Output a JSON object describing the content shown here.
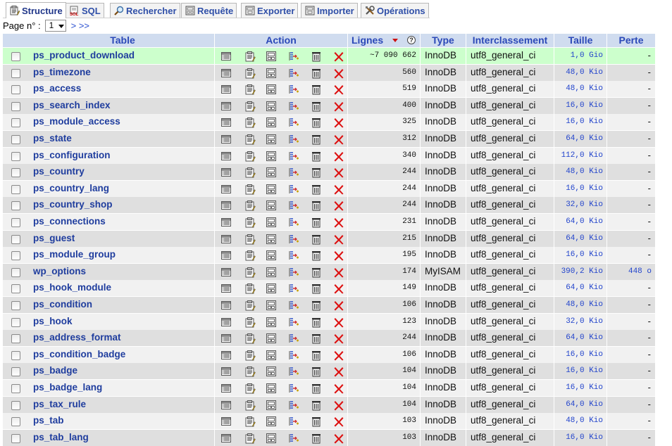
{
  "tabs": [
    {
      "label": "Structure",
      "icon": "structure-icon",
      "active": true
    },
    {
      "label": "SQL",
      "icon": "sql-icon",
      "active": false
    },
    {
      "label": "Rechercher",
      "icon": "search-icon",
      "active": false
    },
    {
      "label": "Requête",
      "icon": "query-icon",
      "active": false
    },
    {
      "label": "Exporter",
      "icon": "export-icon",
      "active": false
    },
    {
      "label": "Importer",
      "icon": "import-icon",
      "active": false
    },
    {
      "label": "Opérations",
      "icon": "operations-icon",
      "active": false
    }
  ],
  "pager": {
    "label": "Page n° :",
    "selected": "1",
    "next": "> >>"
  },
  "columns": {
    "table": "Table",
    "action": "Action",
    "lignes": "Lignes",
    "help": "?",
    "type": "Type",
    "collation": "Interclassement",
    "size": "Taille",
    "loss": "Perte"
  },
  "action_icons": [
    "browse-icon",
    "structure-icon",
    "search-icon",
    "insert-icon",
    "empty-icon",
    "drop-icon"
  ],
  "colors": {
    "header_bg": "#d0dcef",
    "row_odd": "#f1f1f1",
    "row_even": "#dfdfdf",
    "row_highlight": "#ccffcc",
    "link": "#1f3d9e"
  },
  "rows": [
    {
      "name": "ps_product_download",
      "rows": "~7 090 662",
      "type": "InnoDB",
      "collation": "utf8_general_ci",
      "size": "1,0 Gio",
      "loss": "-"
    },
    {
      "name": "ps_timezone",
      "rows": "560",
      "type": "InnoDB",
      "collation": "utf8_general_ci",
      "size": "48,0 Kio",
      "loss": "-"
    },
    {
      "name": "ps_access",
      "rows": "519",
      "type": "InnoDB",
      "collation": "utf8_general_ci",
      "size": "48,0 Kio",
      "loss": "-"
    },
    {
      "name": "ps_search_index",
      "rows": "400",
      "type": "InnoDB",
      "collation": "utf8_general_ci",
      "size": "16,0 Kio",
      "loss": "-"
    },
    {
      "name": "ps_module_access",
      "rows": "325",
      "type": "InnoDB",
      "collation": "utf8_general_ci",
      "size": "16,0 Kio",
      "loss": "-"
    },
    {
      "name": "ps_state",
      "rows": "312",
      "type": "InnoDB",
      "collation": "utf8_general_ci",
      "size": "64,0 Kio",
      "loss": "-"
    },
    {
      "name": "ps_configuration",
      "rows": "340",
      "type": "InnoDB",
      "collation": "utf8_general_ci",
      "size": "112,0 Kio",
      "loss": "-"
    },
    {
      "name": "ps_country",
      "rows": "244",
      "type": "InnoDB",
      "collation": "utf8_general_ci",
      "size": "48,0 Kio",
      "loss": "-"
    },
    {
      "name": "ps_country_lang",
      "rows": "244",
      "type": "InnoDB",
      "collation": "utf8_general_ci",
      "size": "16,0 Kio",
      "loss": "-"
    },
    {
      "name": "ps_country_shop",
      "rows": "244",
      "type": "InnoDB",
      "collation": "utf8_general_ci",
      "size": "32,0 Kio",
      "loss": "-"
    },
    {
      "name": "ps_connections",
      "rows": "231",
      "type": "InnoDB",
      "collation": "utf8_general_ci",
      "size": "64,0 Kio",
      "loss": "-"
    },
    {
      "name": "ps_guest",
      "rows": "215",
      "type": "InnoDB",
      "collation": "utf8_general_ci",
      "size": "64,0 Kio",
      "loss": "-"
    },
    {
      "name": "ps_module_group",
      "rows": "195",
      "type": "InnoDB",
      "collation": "utf8_general_ci",
      "size": "16,0 Kio",
      "loss": "-"
    },
    {
      "name": "wp_options",
      "rows": "174",
      "type": "MyISAM",
      "collation": "utf8_general_ci",
      "size": "390,2 Kio",
      "loss": "448 o"
    },
    {
      "name": "ps_hook_module",
      "rows": "149",
      "type": "InnoDB",
      "collation": "utf8_general_ci",
      "size": "64,0 Kio",
      "loss": "-"
    },
    {
      "name": "ps_condition",
      "rows": "106",
      "type": "InnoDB",
      "collation": "utf8_general_ci",
      "size": "48,0 Kio",
      "loss": "-"
    },
    {
      "name": "ps_hook",
      "rows": "123",
      "type": "InnoDB",
      "collation": "utf8_general_ci",
      "size": "32,0 Kio",
      "loss": "-"
    },
    {
      "name": "ps_address_format",
      "rows": "244",
      "type": "InnoDB",
      "collation": "utf8_general_ci",
      "size": "64,0 Kio",
      "loss": "-"
    },
    {
      "name": "ps_condition_badge",
      "rows": "106",
      "type": "InnoDB",
      "collation": "utf8_general_ci",
      "size": "16,0 Kio",
      "loss": "-"
    },
    {
      "name": "ps_badge",
      "rows": "104",
      "type": "InnoDB",
      "collation": "utf8_general_ci",
      "size": "16,0 Kio",
      "loss": "-"
    },
    {
      "name": "ps_badge_lang",
      "rows": "104",
      "type": "InnoDB",
      "collation": "utf8_general_ci",
      "size": "16,0 Kio",
      "loss": "-"
    },
    {
      "name": "ps_tax_rule",
      "rows": "104",
      "type": "InnoDB",
      "collation": "utf8_general_ci",
      "size": "64,0 Kio",
      "loss": "-"
    },
    {
      "name": "ps_tab",
      "rows": "103",
      "type": "InnoDB",
      "collation": "utf8_general_ci",
      "size": "48,0 Kio",
      "loss": "-"
    },
    {
      "name": "ps_tab_lang",
      "rows": "103",
      "type": "InnoDB",
      "collation": "utf8_general_ci",
      "size": "16,0 Kio",
      "loss": "-"
    }
  ]
}
